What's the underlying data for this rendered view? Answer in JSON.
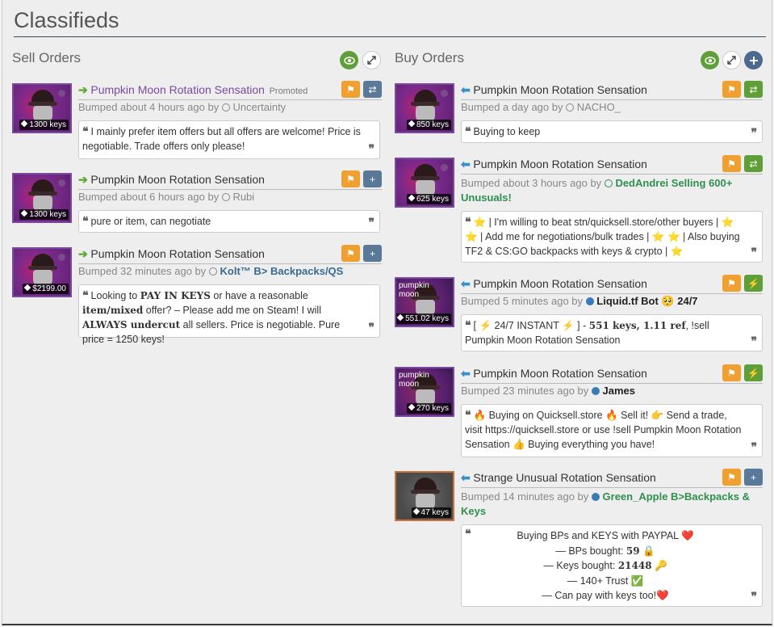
{
  "page_title": "Classifieds",
  "sell": {
    "title": "Sell Orders",
    "listings": [
      {
        "item": "Pumpkin Moon Rotation Sensation",
        "promoted": "Promoted",
        "price": "1300 keys",
        "bumped": "Bumped about 4 hours ago by",
        "user": "Uncertainty",
        "comment": "I mainly prefer item offers but all offers are welcome! Price is negotiable. Trade offers only please!"
      },
      {
        "item": "Pumpkin Moon Rotation Sensation",
        "price": "1300 keys",
        "bumped": "Bumped about 6 hours ago by",
        "user": "Rubi",
        "comment": "pure or item, can negotiate"
      },
      {
        "item": "Pumpkin Moon Rotation Sensation",
        "price": "$2199.00",
        "bumped": "Bumped 32 minutes ago by",
        "user": "Kolt™ B> Backpacks/QS",
        "comment_parts": [
          "Looking to ",
          "PAY IN KEYS",
          " or have a reasonable ",
          "item/mixed",
          " offer? – Please add me on Steam! I will ",
          "ALWAYS undercut",
          " all sellers. Price is negotiable. Pure price = 1250 keys!"
        ]
      }
    ]
  },
  "buy": {
    "title": "Buy Orders",
    "listings": [
      {
        "item": "Pumpkin Moon Rotation Sensation",
        "price": "850 keys",
        "bumped": "Bumped a day ago by",
        "user": "NACHO_",
        "comment": "Buying to keep"
      },
      {
        "item": "Pumpkin Moon Rotation Sensation",
        "price": "625 keys",
        "bumped": "Bumped about 3 hours ago by",
        "user": "DedAndrei Selling 600+ Unusuals!",
        "comment": "⭐ | I'm willing to beat stn/quicksell.store/other buyers | ⭐ ⭐ | Add me for negotiations/bulk trades | ⭐ ⭐ | Also buying TF2 & CS:GO backpacks with keys & crypto | ⭐"
      },
      {
        "item": "Pumpkin Moon Rotation Sensation",
        "overlay": "pumpkin moon",
        "price": "551.02 keys",
        "bumped": "Bumped 5 minutes ago by",
        "user": "Liquid.tf Bot 🥺 24/7",
        "comment_parts": [
          "[ ⚡ 24/7 INSTANT ⚡ ] - ",
          "551 keys, 1.11 ref",
          ", !sell Pumpkin Moon Rotation Sensation"
        ]
      },
      {
        "item": "Pumpkin Moon Rotation Sensation",
        "overlay": "pumpkin moon",
        "price": "270 keys",
        "bumped": "Bumped 23 minutes ago by",
        "user": "James",
        "comment": "🔥 Buying on Quicksell.store 🔥  Sell it! 👉 Send a trade, visit https://quicksell.store or use !sell Pumpkin Moon Rotation Sensation 👍 Buying everything you have!"
      },
      {
        "item": "Strange Unusual Rotation Sensation",
        "price": "47 keys",
        "bumped": "Bumped 14 minutes ago by",
        "user": "Green_Apple B>Backpacks & Keys",
        "lines": [
          "Buying BPs and KEYS with PAYPAL ❤️",
          "— BPs bought: ",
          "59",
          " 🔒",
          "— Keys bought: ",
          "21448",
          " 🔑",
          "— 140+ Trust ✅",
          "— Can pay with keys too!❤️"
        ]
      }
    ]
  },
  "colors": {
    "sell_arrow": "#5fa832",
    "buy_arrow": "#3a8fc8",
    "flag": "#f0a030",
    "trade": "#5a7898",
    "green": "#5f9f3a",
    "unusual_border": "#7a4aa0",
    "strange_border": "#c8743a"
  }
}
